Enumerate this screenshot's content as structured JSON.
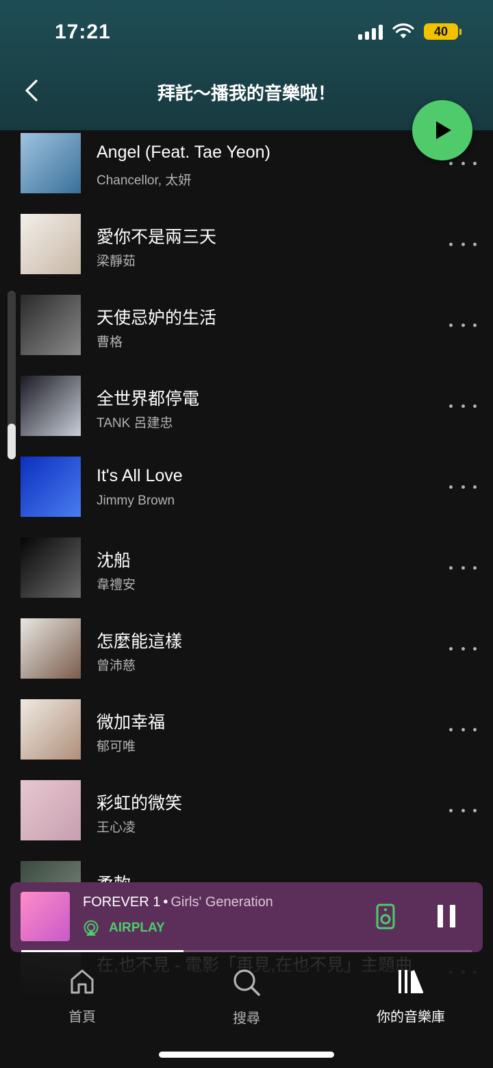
{
  "status_bar": {
    "time": "17:21",
    "battery": "40"
  },
  "header": {
    "title": "拜託～播我的音樂啦！"
  },
  "tracks": [
    {
      "title": "Angel (Feat. Tae Yeon)",
      "artist": "Chancellor, 太妍",
      "color1": "#9ec4df",
      "color2": "#3a6f9a"
    },
    {
      "title": "愛你不是兩三天",
      "artist": "梁靜茹",
      "color1": "#f3efe9",
      "color2": "#c7b7a5"
    },
    {
      "title": "天使忌妒的生活",
      "artist": "曹格",
      "color1": "#2a2a2a",
      "color2": "#8a8a8a"
    },
    {
      "title": "全世界都停電",
      "artist": "TANK 呂建忠",
      "color1": "#1a1a24",
      "color2": "#c9ced8"
    },
    {
      "title": "It's All Love",
      "artist": "Jimmy Brown",
      "color1": "#0b2fbf",
      "color2": "#4a7df0"
    },
    {
      "title": "沈船",
      "artist": "韋禮安",
      "color1": "#050505",
      "color2": "#6b6b6b"
    },
    {
      "title": "怎麼能這樣",
      "artist": "曾沛慈",
      "color1": "#e8e6e2",
      "color2": "#7a5d4c"
    },
    {
      "title": "微加幸福",
      "artist": "郁可唯",
      "color1": "#efe9e2",
      "color2": "#b08f7a"
    },
    {
      "title": "彩虹的微笑",
      "artist": "王心凌",
      "color1": "#e7c7d0",
      "color2": "#c79fb0"
    },
    {
      "title": "柔軟",
      "artist": "",
      "color1": "#3b4a40",
      "color2": "#7d8a7f"
    },
    {
      "title": "在,也不見 - 電影「再見,在也不見」主題曲",
      "artist": "",
      "color1": "#333333",
      "color2": "#555555"
    }
  ],
  "now_playing": {
    "song": "FOREVER 1",
    "separator": "•",
    "artist": "Girls' Generation",
    "device": "AIRPLAY",
    "progress": 0.36
  },
  "nav": [
    {
      "label": "首頁",
      "icon": "home-icon"
    },
    {
      "label": "搜尋",
      "icon": "search-icon"
    },
    {
      "label": "你的音樂庫",
      "icon": "library-icon"
    }
  ],
  "colors": {
    "accent": "#4fcb6b",
    "mini_player_bg": "#5c2f5a",
    "background": "#121212"
  }
}
